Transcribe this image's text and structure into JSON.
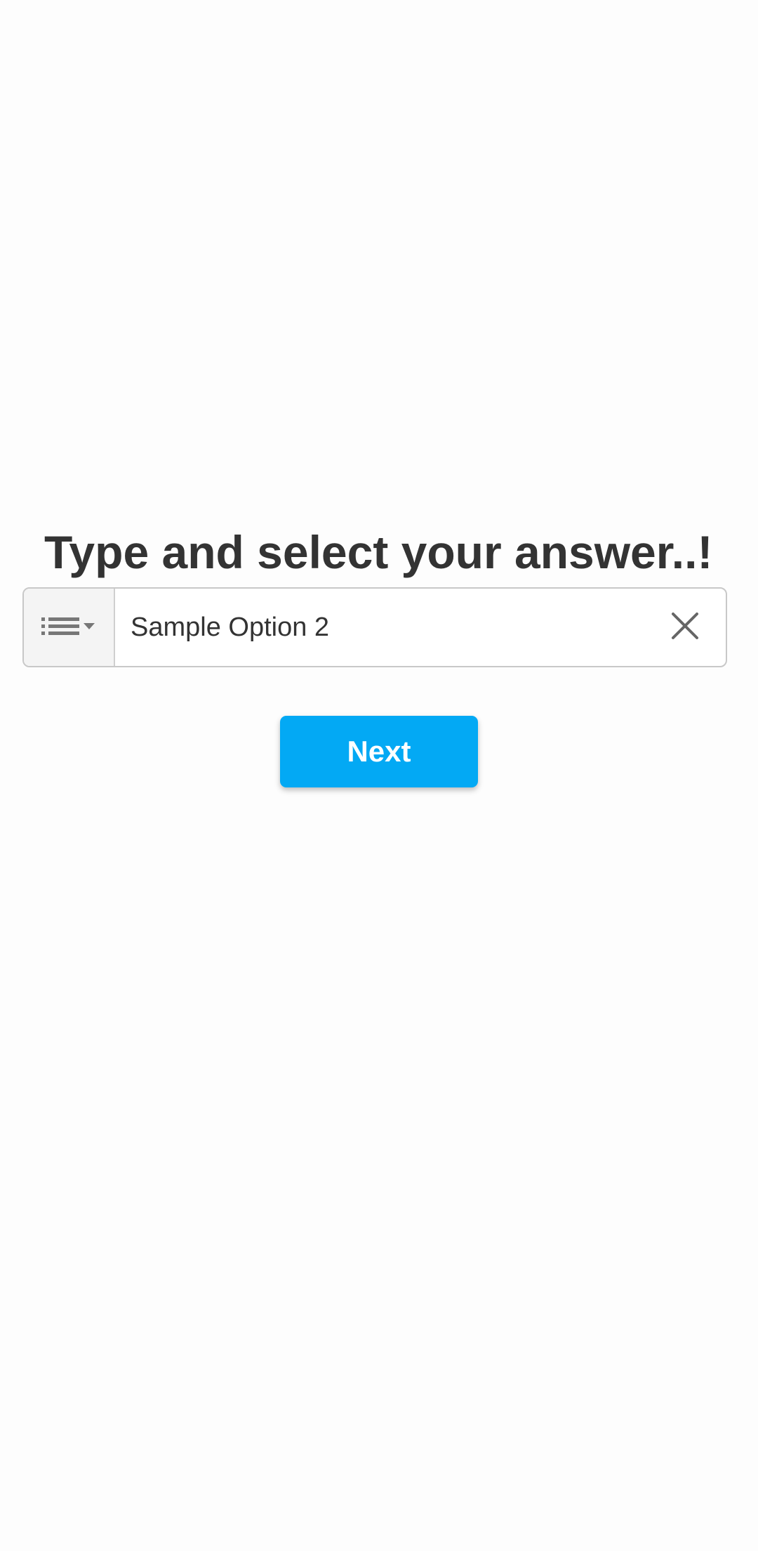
{
  "question": {
    "title": "Type and select your answer..!"
  },
  "answer_select": {
    "toggle_icon": "list-dropdown-icon",
    "value": "Sample Option 2",
    "clear_icon": "close-icon"
  },
  "actions": {
    "next_label": "Next"
  },
  "colors": {
    "accent": "#03a9f4",
    "text": "#333333",
    "background": "#fdfdfd",
    "border": "#c8c8c8"
  }
}
